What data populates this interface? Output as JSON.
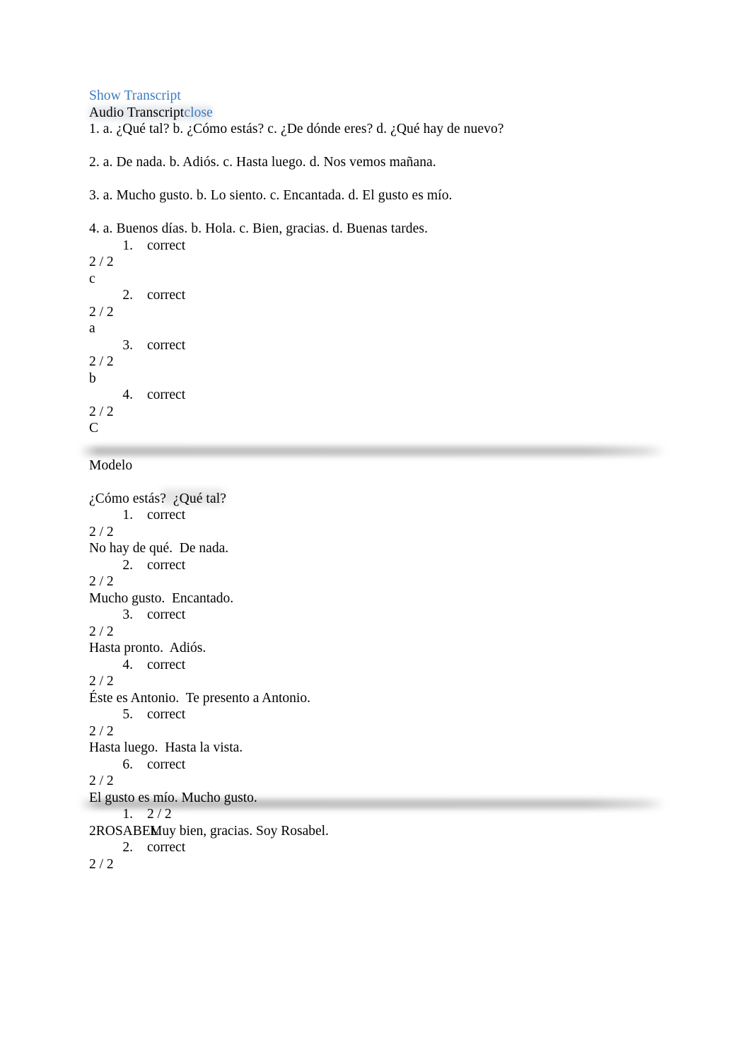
{
  "document": {
    "title": "Audio Transcript quiz results",
    "link_color": "#3b7abf",
    "text_color": "#000000"
  },
  "header": {
    "show_transcript": "Show Transcript",
    "audio_transcript_label": "Audio Transcript",
    "close_label": "close"
  },
  "transcript": {
    "items": [
      "1. a. ¿Qué tal? b. ¿Cómo estás? c. ¿De dónde eres? d. ¿Qué hay de nuevo?",
      "2. a. De nada. b. Adiós. c. Hasta luego. d. Nos vemos mañana.",
      "3. a. Mucho gusto. b. Lo siento. c. Encantada. d. El gusto es mío.",
      "4. a. Buenos días. b. Hola. c. Bien, gracias. d. Buenas tardes."
    ]
  },
  "section_one": {
    "results": [
      {
        "number": "1.",
        "status": "correct",
        "score": "2 / 2",
        "answer": "c"
      },
      {
        "number": "2.",
        "status": "correct",
        "score": "2 / 2",
        "answer": "a"
      },
      {
        "number": "3.",
        "status": "correct",
        "score": "2 / 2",
        "answer": "b"
      },
      {
        "number": "4.",
        "status": "correct",
        "score": "2 / 2",
        "answer": "C"
      }
    ]
  },
  "section_two": {
    "heading": "Modelo",
    "prompt": "¿Cómo estás?  ¿Qué tal?",
    "results": [
      {
        "number": "1.",
        "status": "correct",
        "score": "2 / 2",
        "answer": "No hay de qué.  De nada."
      },
      {
        "number": "2.",
        "status": "correct",
        "score": "2 / 2",
        "answer": "Mucho gusto.  Encantado."
      },
      {
        "number": "3.",
        "status": "correct",
        "score": "2 / 2",
        "answer": "Hasta pronto.  Adiós."
      },
      {
        "number": "4.",
        "status": "correct",
        "score": "2 / 2",
        "answer": "Éste es Antonio.  Te presento a Antonio."
      },
      {
        "number": "5.",
        "status": "correct",
        "score": "2 / 2",
        "answer": "Hasta luego.  Hasta la vista."
      },
      {
        "number": "6.",
        "status": "correct",
        "score": "2 / 2",
        "answer": "El gusto es mío. Mucho gusto."
      }
    ]
  },
  "section_three": {
    "results": [
      {
        "number": "1.",
        "status": "2 / 2",
        "speaker_label": "2ROSABEL",
        "answer": "Muy bien, gracias. Soy Rosabel."
      },
      {
        "number": "2.",
        "status": "correct",
        "score": "2 / 2"
      }
    ]
  }
}
